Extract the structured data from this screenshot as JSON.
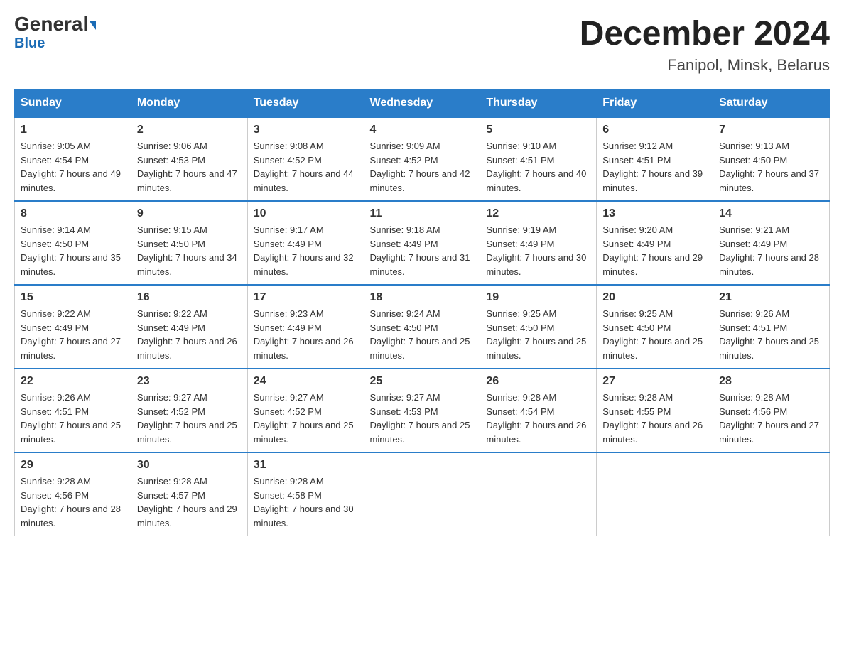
{
  "header": {
    "logo_main": "General",
    "logo_sub": "Blue",
    "title": "December 2024",
    "subtitle": "Fanipol, Minsk, Belarus"
  },
  "calendar": {
    "days_of_week": [
      "Sunday",
      "Monday",
      "Tuesday",
      "Wednesday",
      "Thursday",
      "Friday",
      "Saturday"
    ],
    "weeks": [
      [
        {
          "day": "1",
          "sunrise": "9:05 AM",
          "sunset": "4:54 PM",
          "daylight": "7 hours and 49 minutes."
        },
        {
          "day": "2",
          "sunrise": "9:06 AM",
          "sunset": "4:53 PM",
          "daylight": "7 hours and 47 minutes."
        },
        {
          "day": "3",
          "sunrise": "9:08 AM",
          "sunset": "4:52 PM",
          "daylight": "7 hours and 44 minutes."
        },
        {
          "day": "4",
          "sunrise": "9:09 AM",
          "sunset": "4:52 PM",
          "daylight": "7 hours and 42 minutes."
        },
        {
          "day": "5",
          "sunrise": "9:10 AM",
          "sunset": "4:51 PM",
          "daylight": "7 hours and 40 minutes."
        },
        {
          "day": "6",
          "sunrise": "9:12 AM",
          "sunset": "4:51 PM",
          "daylight": "7 hours and 39 minutes."
        },
        {
          "day": "7",
          "sunrise": "9:13 AM",
          "sunset": "4:50 PM",
          "daylight": "7 hours and 37 minutes."
        }
      ],
      [
        {
          "day": "8",
          "sunrise": "9:14 AM",
          "sunset": "4:50 PM",
          "daylight": "7 hours and 35 minutes."
        },
        {
          "day": "9",
          "sunrise": "9:15 AM",
          "sunset": "4:50 PM",
          "daylight": "7 hours and 34 minutes."
        },
        {
          "day": "10",
          "sunrise": "9:17 AM",
          "sunset": "4:49 PM",
          "daylight": "7 hours and 32 minutes."
        },
        {
          "day": "11",
          "sunrise": "9:18 AM",
          "sunset": "4:49 PM",
          "daylight": "7 hours and 31 minutes."
        },
        {
          "day": "12",
          "sunrise": "9:19 AM",
          "sunset": "4:49 PM",
          "daylight": "7 hours and 30 minutes."
        },
        {
          "day": "13",
          "sunrise": "9:20 AM",
          "sunset": "4:49 PM",
          "daylight": "7 hours and 29 minutes."
        },
        {
          "day": "14",
          "sunrise": "9:21 AM",
          "sunset": "4:49 PM",
          "daylight": "7 hours and 28 minutes."
        }
      ],
      [
        {
          "day": "15",
          "sunrise": "9:22 AM",
          "sunset": "4:49 PM",
          "daylight": "7 hours and 27 minutes."
        },
        {
          "day": "16",
          "sunrise": "9:22 AM",
          "sunset": "4:49 PM",
          "daylight": "7 hours and 26 minutes."
        },
        {
          "day": "17",
          "sunrise": "9:23 AM",
          "sunset": "4:49 PM",
          "daylight": "7 hours and 26 minutes."
        },
        {
          "day": "18",
          "sunrise": "9:24 AM",
          "sunset": "4:50 PM",
          "daylight": "7 hours and 25 minutes."
        },
        {
          "day": "19",
          "sunrise": "9:25 AM",
          "sunset": "4:50 PM",
          "daylight": "7 hours and 25 minutes."
        },
        {
          "day": "20",
          "sunrise": "9:25 AM",
          "sunset": "4:50 PM",
          "daylight": "7 hours and 25 minutes."
        },
        {
          "day": "21",
          "sunrise": "9:26 AM",
          "sunset": "4:51 PM",
          "daylight": "7 hours and 25 minutes."
        }
      ],
      [
        {
          "day": "22",
          "sunrise": "9:26 AM",
          "sunset": "4:51 PM",
          "daylight": "7 hours and 25 minutes."
        },
        {
          "day": "23",
          "sunrise": "9:27 AM",
          "sunset": "4:52 PM",
          "daylight": "7 hours and 25 minutes."
        },
        {
          "day": "24",
          "sunrise": "9:27 AM",
          "sunset": "4:52 PM",
          "daylight": "7 hours and 25 minutes."
        },
        {
          "day": "25",
          "sunrise": "9:27 AM",
          "sunset": "4:53 PM",
          "daylight": "7 hours and 25 minutes."
        },
        {
          "day": "26",
          "sunrise": "9:28 AM",
          "sunset": "4:54 PM",
          "daylight": "7 hours and 26 minutes."
        },
        {
          "day": "27",
          "sunrise": "9:28 AM",
          "sunset": "4:55 PM",
          "daylight": "7 hours and 26 minutes."
        },
        {
          "day": "28",
          "sunrise": "9:28 AM",
          "sunset": "4:56 PM",
          "daylight": "7 hours and 27 minutes."
        }
      ],
      [
        {
          "day": "29",
          "sunrise": "9:28 AM",
          "sunset": "4:56 PM",
          "daylight": "7 hours and 28 minutes."
        },
        {
          "day": "30",
          "sunrise": "9:28 AM",
          "sunset": "4:57 PM",
          "daylight": "7 hours and 29 minutes."
        },
        {
          "day": "31",
          "sunrise": "9:28 AM",
          "sunset": "4:58 PM",
          "daylight": "7 hours and 30 minutes."
        },
        null,
        null,
        null,
        null
      ]
    ]
  }
}
